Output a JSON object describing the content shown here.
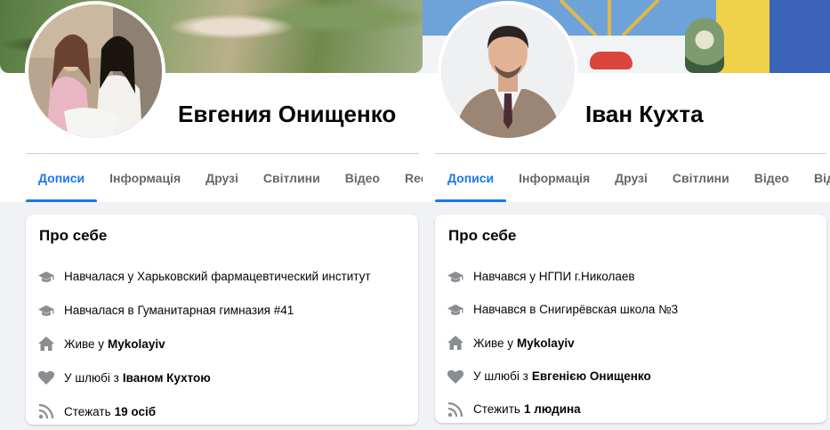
{
  "profiles": [
    {
      "name": "Евгения Онищенко",
      "tabs": [
        "Дописи",
        "Інформація",
        "Друзі",
        "Світлини",
        "Відео",
        "Reels"
      ],
      "about": {
        "title": "Про себе",
        "items": [
          {
            "icon": "graduation-cap-icon",
            "text": "Навчалася у Харьковский фармацевтический институт",
            "bold": ""
          },
          {
            "icon": "graduation-cap-icon",
            "text": "Навчалася в Гуманитарная гимназия #41",
            "bold": ""
          },
          {
            "icon": "home-icon",
            "text": "Живе у",
            "bold": "Mykolayiv"
          },
          {
            "icon": "heart-icon",
            "text": "У шлюбі з",
            "bold": "Іваном Кухтою"
          },
          {
            "icon": "rss-icon",
            "text": "Стежать",
            "bold": "19 осіб"
          }
        ]
      }
    },
    {
      "name": "Іван Кухта",
      "tabs": [
        "Дописи",
        "Інформація",
        "Друзі",
        "Світлини",
        "Відео",
        "Відмітки"
      ],
      "about": {
        "title": "Про себе",
        "items": [
          {
            "icon": "graduation-cap-icon",
            "text": "Навчався у НГПИ г.Николаев",
            "bold": ""
          },
          {
            "icon": "graduation-cap-icon",
            "text": "Навчався в Снигирёвская школа №3",
            "bold": ""
          },
          {
            "icon": "home-icon",
            "text": "Живе у",
            "bold": "Mykolayiv"
          },
          {
            "icon": "heart-icon",
            "text": "У шлюбі з",
            "bold": "Евгенією Онищенко"
          },
          {
            "icon": "rss-icon",
            "text": "Стежить",
            "bold": "1 людина"
          }
        ]
      }
    }
  ],
  "colors": {
    "accent": "#1877f2",
    "icon_gray": "#8a8d91",
    "text_secondary": "#65676b"
  }
}
